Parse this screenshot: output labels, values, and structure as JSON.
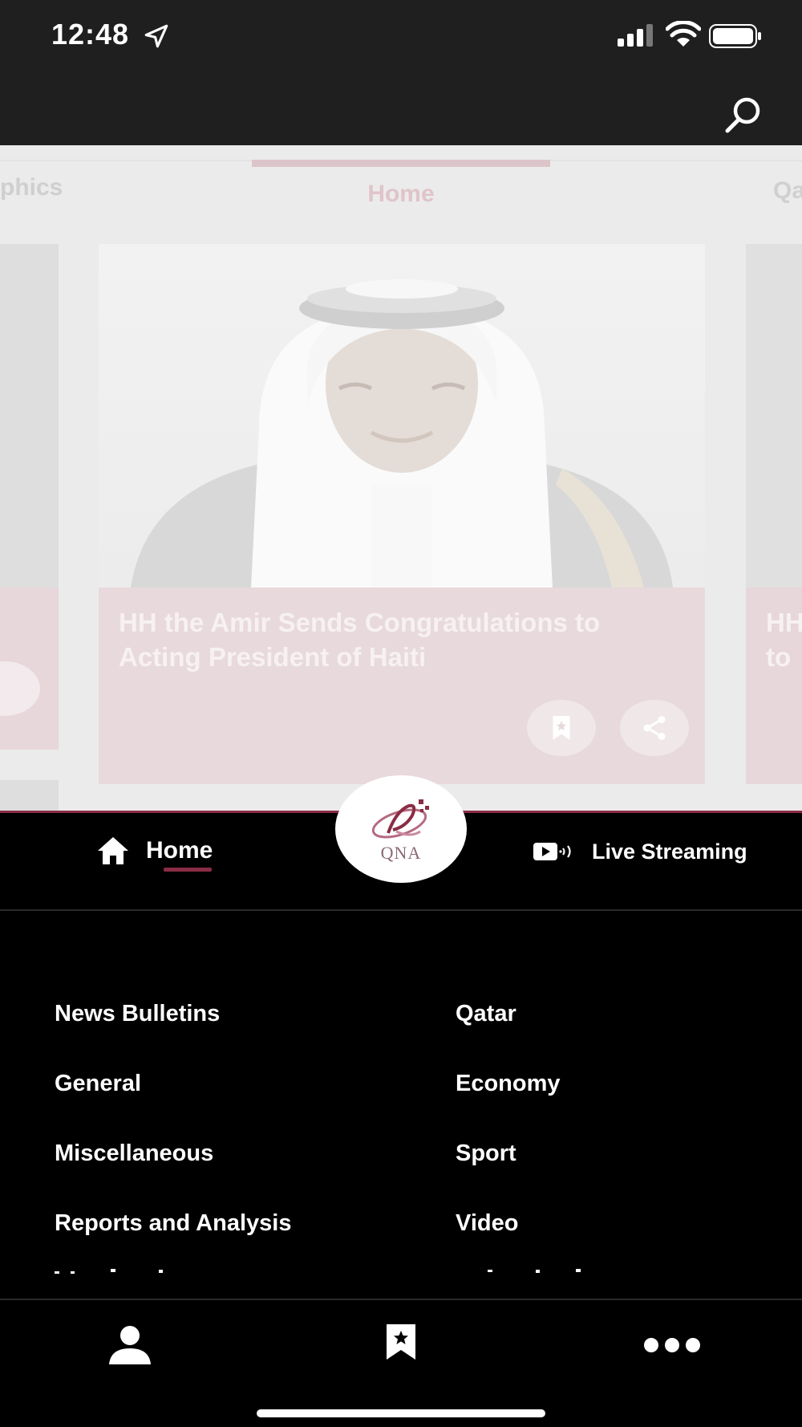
{
  "status_bar": {
    "time": "12:48",
    "icons": [
      "location-arrow-icon",
      "cellular-signal-icon",
      "wifi-icon",
      "battery-icon"
    ]
  },
  "header": {
    "search_icon": "search-icon"
  },
  "tabs": [
    {
      "label": "phics"
    },
    {
      "label": "Home",
      "active": true
    },
    {
      "label": "Qa"
    }
  ],
  "featured_card": {
    "headline": "HH the Amir Sends Congratulations to Acting President of Haiti",
    "actions": [
      "bookmark-icon",
      "share-icon"
    ]
  },
  "next_card": {
    "headline_partial": "HH\nto"
  },
  "nav": {
    "home_label": "Home",
    "logo_text": "QNA",
    "live_label": "Live Streaming"
  },
  "categories": {
    "left": [
      "News Bulletins",
      "General",
      "Miscellaneous",
      "Reports and Analysis"
    ],
    "right": [
      "Qatar",
      "Economy",
      "Sport",
      "Video"
    ]
  },
  "bottom_bar": {
    "icons": [
      "profile-icon",
      "bookmarks-icon",
      "more-icon"
    ]
  },
  "colors": {
    "accent": "#8a2c45",
    "header_bg": "#1f1f1f",
    "menu_bg": "#000000"
  }
}
